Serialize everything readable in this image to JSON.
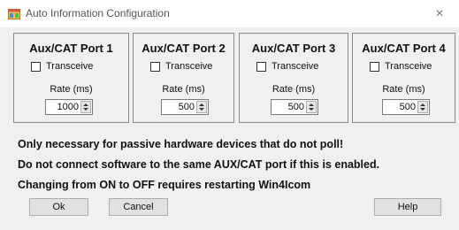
{
  "window": {
    "title": "Auto Information Configuration",
    "close_label": "×"
  },
  "ports": [
    {
      "title": "Aux/CAT Port 1",
      "transceive_label": "Transceive",
      "transceive_checked": false,
      "rate_label": "Rate (ms)",
      "rate_value": "1000"
    },
    {
      "title": "Aux/CAT Port 2",
      "transceive_label": "Transceive",
      "transceive_checked": false,
      "rate_label": "Rate (ms)",
      "rate_value": "500"
    },
    {
      "title": "Aux/CAT Port 3",
      "transceive_label": "Transceive",
      "transceive_checked": false,
      "rate_label": "Rate (ms)",
      "rate_value": "500"
    },
    {
      "title": "Aux/CAT Port 4",
      "transceive_label": "Transceive",
      "transceive_checked": false,
      "rate_label": "Rate (ms)",
      "rate_value": "500"
    }
  ],
  "notes": [
    "Only necessary for passive hardware devices that do not poll!",
    "Do not connect software to the same AUX/CAT port if this is enabled.",
    "Changing from ON to OFF requires restarting Win4Icom"
  ],
  "buttons": {
    "ok": "Ok",
    "cancel": "Cancel",
    "help": "Help"
  },
  "icons": {
    "app": "app-window-icon",
    "close": "close-icon"
  }
}
